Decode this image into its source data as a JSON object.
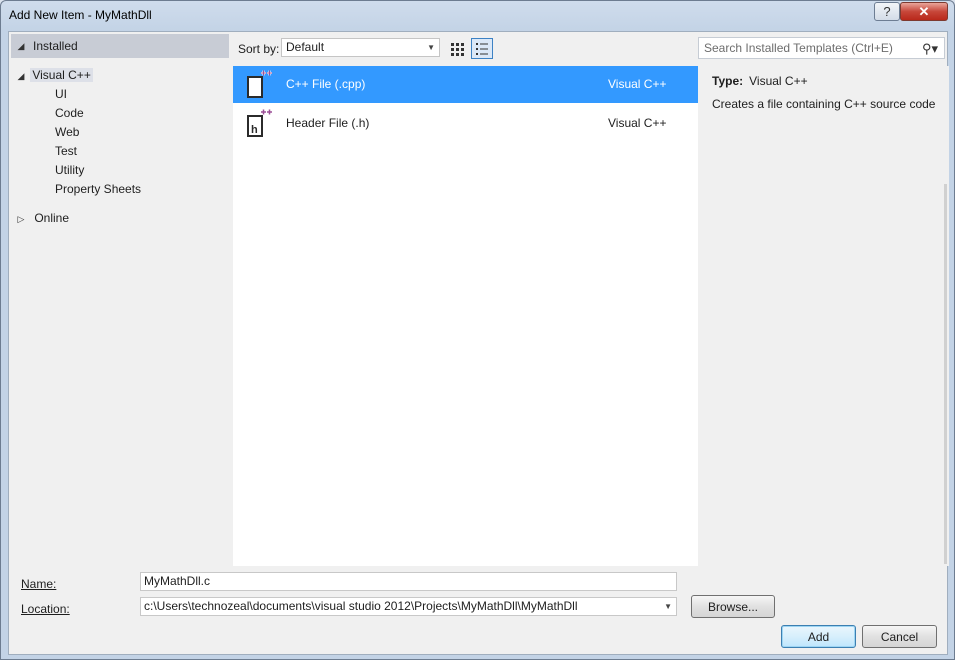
{
  "window": {
    "title": "Add New Item - MyMathDll",
    "help_label": "?",
    "close_label": "✕"
  },
  "left": {
    "installed_label": "Installed",
    "visual_cpp_label": "Visual C++",
    "children": [
      "UI",
      "Code",
      "Web",
      "Test",
      "Utility",
      "Property Sheets"
    ],
    "online_label": "Online"
  },
  "toolbar": {
    "sortby_label": "Sort by:",
    "sort_value": "Default",
    "search_placeholder": "Search Installed Templates (Ctrl+E)"
  },
  "templates": [
    {
      "name": "C++ File (.cpp)",
      "lang": "Visual C++",
      "selected": true
    },
    {
      "name": "Header File (.h)",
      "lang": "Visual C++",
      "selected": false
    }
  ],
  "details": {
    "type_label": "Type:",
    "type_value": "Visual C++",
    "description": "Creates a file containing C++ source code"
  },
  "form": {
    "name_label": "Name:",
    "name_value": "MyMathDll.c",
    "location_label": "Location:",
    "location_value": "c:\\Users\\technozeal\\documents\\visual studio 2012\\Projects\\MyMathDll\\MyMathDll",
    "browse_label": "Browse...",
    "add_label": "Add",
    "cancel_label": "Cancel"
  },
  "colors": {
    "selection": "#3399ff",
    "title_gradient": "#c3d3e6",
    "close_button": "#c7473a"
  }
}
